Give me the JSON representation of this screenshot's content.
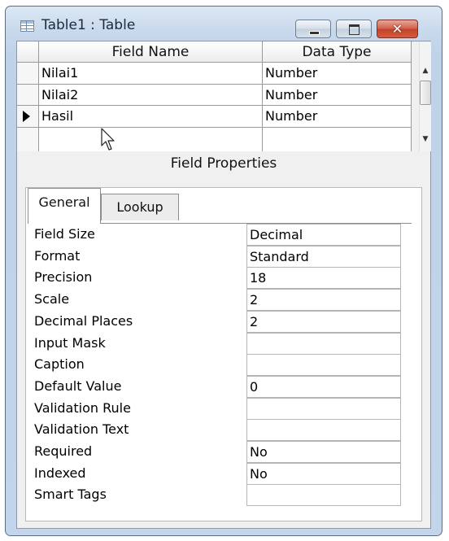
{
  "window": {
    "title": "Table1 : Table",
    "buttons": {
      "minimize": "minimize",
      "maximize": "maximize",
      "close": "✕"
    }
  },
  "design_grid": {
    "columns": [
      "Field Name",
      "Data Type"
    ],
    "rows": [
      {
        "name": "Nilai1",
        "type": "Number"
      },
      {
        "name": "Nilai2",
        "type": "Number"
      },
      {
        "name": "Hasil",
        "type": "Number"
      }
    ],
    "selected_row": "Hasil"
  },
  "field_properties": {
    "title": "Field Properties",
    "tabs": [
      "General",
      "Lookup"
    ],
    "active_tab": "General",
    "properties": [
      {
        "label": "Field Size",
        "value": "Decimal"
      },
      {
        "label": "Format",
        "value": "Standard"
      },
      {
        "label": "Precision",
        "value": "18"
      },
      {
        "label": "Scale",
        "value": "2"
      },
      {
        "label": "Decimal Places",
        "value": "2"
      },
      {
        "label": "Input Mask",
        "value": ""
      },
      {
        "label": "Caption",
        "value": ""
      },
      {
        "label": "Default Value",
        "value": "0"
      },
      {
        "label": "Validation Rule",
        "value": ""
      },
      {
        "label": "Validation Text",
        "value": ""
      },
      {
        "label": "Required",
        "value": "No"
      },
      {
        "label": "Indexed",
        "value": "No"
      },
      {
        "label": "Smart Tags",
        "value": ""
      }
    ]
  },
  "colors": {
    "titlebar": "#c9d9ec",
    "close_button": "#c34128",
    "client_bg": "#f0f0f0"
  }
}
